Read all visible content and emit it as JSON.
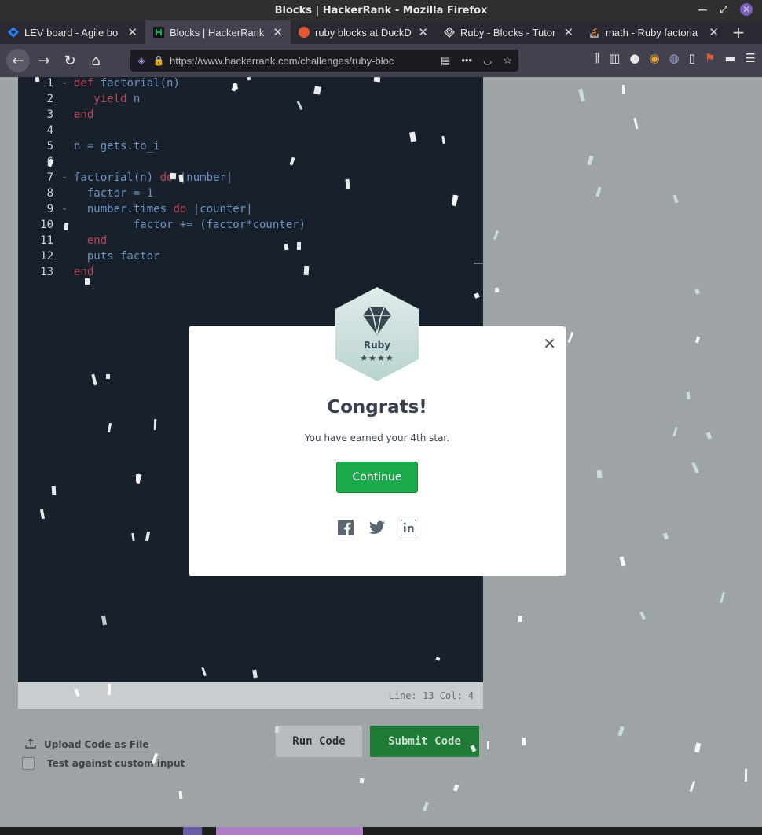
{
  "window": {
    "title": "Blocks | HackerRank - Mozilla Firefox"
  },
  "tabs": [
    {
      "label": "LEV board - Agile bo",
      "icon": "jira-icon",
      "color": "#2684ff"
    },
    {
      "label": "Blocks | HackerRank",
      "icon": "hackerrank-icon",
      "color": "#1ba94c"
    },
    {
      "label": "ruby blocks at DuckD",
      "icon": "duckduckgo-icon",
      "color": "#de5833"
    },
    {
      "label": "Ruby - Blocks - Tutor",
      "icon": "tutorialspoint-icon",
      "color": "#cccccc"
    },
    {
      "label": "math - Ruby factoria",
      "icon": "stackoverflow-icon",
      "color": "#f48024"
    }
  ],
  "address_bar": {
    "url": "https://www.hackerrank.com/challenges/ruby-bloc"
  },
  "editor": {
    "line_numbers": [
      "1",
      "2",
      "3",
      "4",
      "5",
      "6",
      "7",
      "8",
      "9",
      "10",
      "11",
      "12",
      "13"
    ],
    "lines": [
      [
        {
          "t": "def",
          "k": true
        },
        {
          "t": " factorial(n)"
        }
      ],
      [
        {
          "t": "   "
        },
        {
          "t": "yield",
          "k": true
        },
        {
          "t": " n"
        }
      ],
      [
        {
          "t": "end",
          "k": true
        }
      ],
      [
        {
          "t": ""
        }
      ],
      [
        {
          "t": "n = gets.to_i"
        }
      ],
      [
        {
          "t": ""
        }
      ],
      [
        {
          "t": "factorial(n) "
        },
        {
          "t": "do",
          "k": true
        },
        {
          "t": " |number|"
        }
      ],
      [
        {
          "t": "  factor = 1"
        }
      ],
      [
        {
          "t": "  number.times "
        },
        {
          "t": "do",
          "k": true
        },
        {
          "t": " |counter|"
        }
      ],
      [
        {
          "t": "         factor += (factor*counter)"
        }
      ],
      [
        {
          "t": "  "
        },
        {
          "t": "end",
          "k": true
        }
      ],
      [
        {
          "t": "  puts factor"
        }
      ],
      [
        {
          "t": "end",
          "k": true
        }
      ]
    ],
    "status": "Line: 13 Col: 4"
  },
  "actions": {
    "upload_label": "Upload Code as File",
    "custom_input_label": "Test against custom input",
    "run_label": "Run Code",
    "submit_label": "Submit Code"
  },
  "modal": {
    "badge_label": "Ruby",
    "badge_stars": "★★★★",
    "title": "Congrats!",
    "message": "You have earned your 4th star.",
    "continue_label": "Continue"
  },
  "colors": {
    "brand_green": "#1ba94c",
    "editor_bg": "#18202b",
    "keyword": "#b5475a",
    "code": "#6e94c2"
  }
}
